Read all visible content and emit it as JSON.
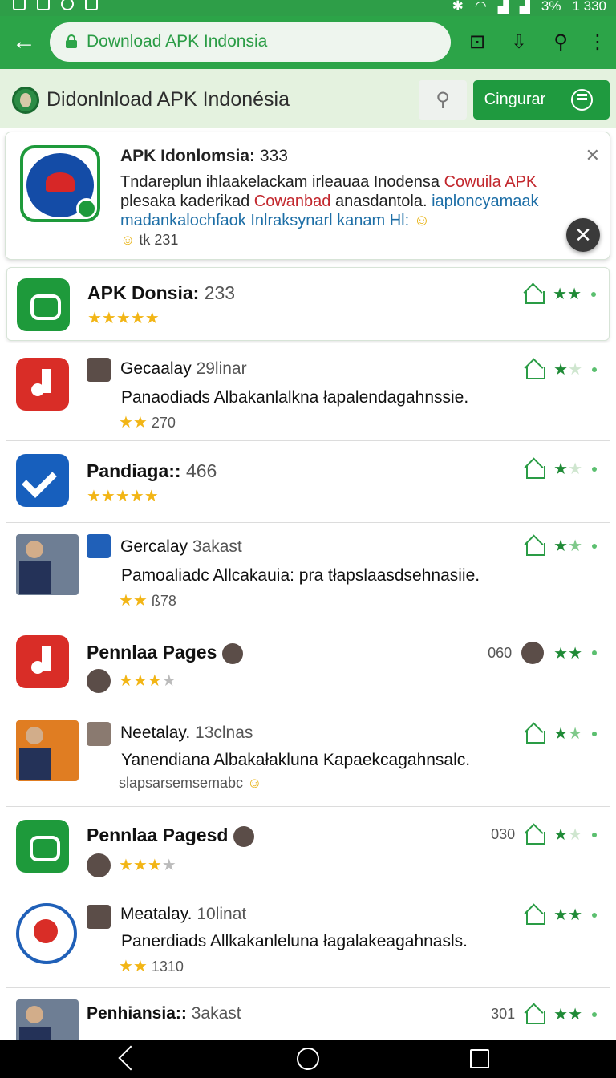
{
  "status": {
    "time": "1 330",
    "battery": "3%"
  },
  "url": {
    "text": "Download APK Indonsia"
  },
  "header": {
    "site_title": "Didonlnload APK Indonésia",
    "cta_label": "Cingurar"
  },
  "featured": {
    "title": "APK Idonlomsia:",
    "count": "333",
    "desc_line1_a": "Tndareplun ihlaakelackam irleauaa Inodensa",
    "desc_line1_b": "Cowuila APK",
    "desc_line2_a": "plesaka kaderikad",
    "desc_line2_b": "Cowanbad",
    "desc_line2_c": "anasdantola.",
    "desc_line2_d": "iaploncyamaak",
    "desc_line3": "madankalochfaok Inlraksynarl kanam Hl:",
    "stats": "tk 231"
  },
  "items": [
    {
      "title": "APK Donsia:",
      "count": "233",
      "stars": "★★★★★"
    },
    {
      "title": "Gecaalay",
      "count": "29linar",
      "desc": "Panaodiads Albakanlalkna łapalendagahnssie.",
      "meta_stars": "★★",
      "meta": "270"
    },
    {
      "title": "Pandiaga::",
      "count": "466",
      "stars": "★★★★★"
    },
    {
      "title": "Gercalay",
      "count": "3akast",
      "desc": "Pamoaliadc Allcakauia: pra tłapslaasdsehnasiie.",
      "meta_stars": "★★",
      "meta": "ß78"
    },
    {
      "title": "Pennlaa Pages",
      "right_num": "060",
      "stars_on": "★★★",
      "stars_off": "★"
    },
    {
      "title": "Neetalay.",
      "count": "13clnas",
      "desc": "Yanendiana Albakałakluna Kapaekcagahnsalc.",
      "meta": "slapsarsemsemabc"
    },
    {
      "title": "Pennlaa Pagesd",
      "right_num": "030",
      "stars_on": "★★★",
      "stars_off": "★"
    },
    {
      "title": "Meatalay.",
      "count": "10linat",
      "desc": "Panerdiads Allkakanleluna łagalakeagahnasls.",
      "meta_stars": "★★",
      "meta": "1310"
    },
    {
      "title": "Penhiansia::",
      "count": "3akast",
      "right_num": "301"
    }
  ]
}
